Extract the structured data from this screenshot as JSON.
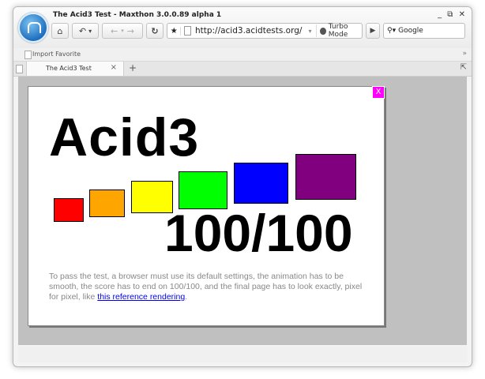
{
  "window": {
    "title": "The Acid3 Test - Maxthon 3.0.0.89 alpha 1",
    "controls": "_ ⧉ ✕"
  },
  "navbar": {
    "home_icon": "⌂",
    "undo_icon": "↶",
    "dropdown_icon": "▾",
    "back_icon": "←",
    "forward_icon": "→",
    "refresh_icon": "↻",
    "star_icon": "★",
    "url": "http://acid3.acidtests.org/",
    "turbo_label": "Turbo Mode",
    "play_icon": "▶",
    "search_engine": "Google"
  },
  "favbar": {
    "import_label": "Import Favorite",
    "more_icon": "»"
  },
  "tabs": {
    "active_label": "The Acid3 Test",
    "close_icon": "×",
    "new_tab_icon": "+",
    "restore_icon": "⇱"
  },
  "acid3": {
    "close_label": "X",
    "title": "Acid3",
    "score": "100/100",
    "description_prefix": "To pass the test, a browser must use its default settings, the animation has to be smooth, the score has to end on 100/100, and the final page has to look exactly, pixel for pixel, like ",
    "link_text": "this reference rendering",
    "description_suffix": ".",
    "boxes": [
      {
        "color": "#ff0000"
      },
      {
        "color": "#ffa500"
      },
      {
        "color": "#ffff00"
      },
      {
        "color": "#00ff00"
      },
      {
        "color": "#0000ff"
      },
      {
        "color": "#800080"
      }
    ]
  }
}
